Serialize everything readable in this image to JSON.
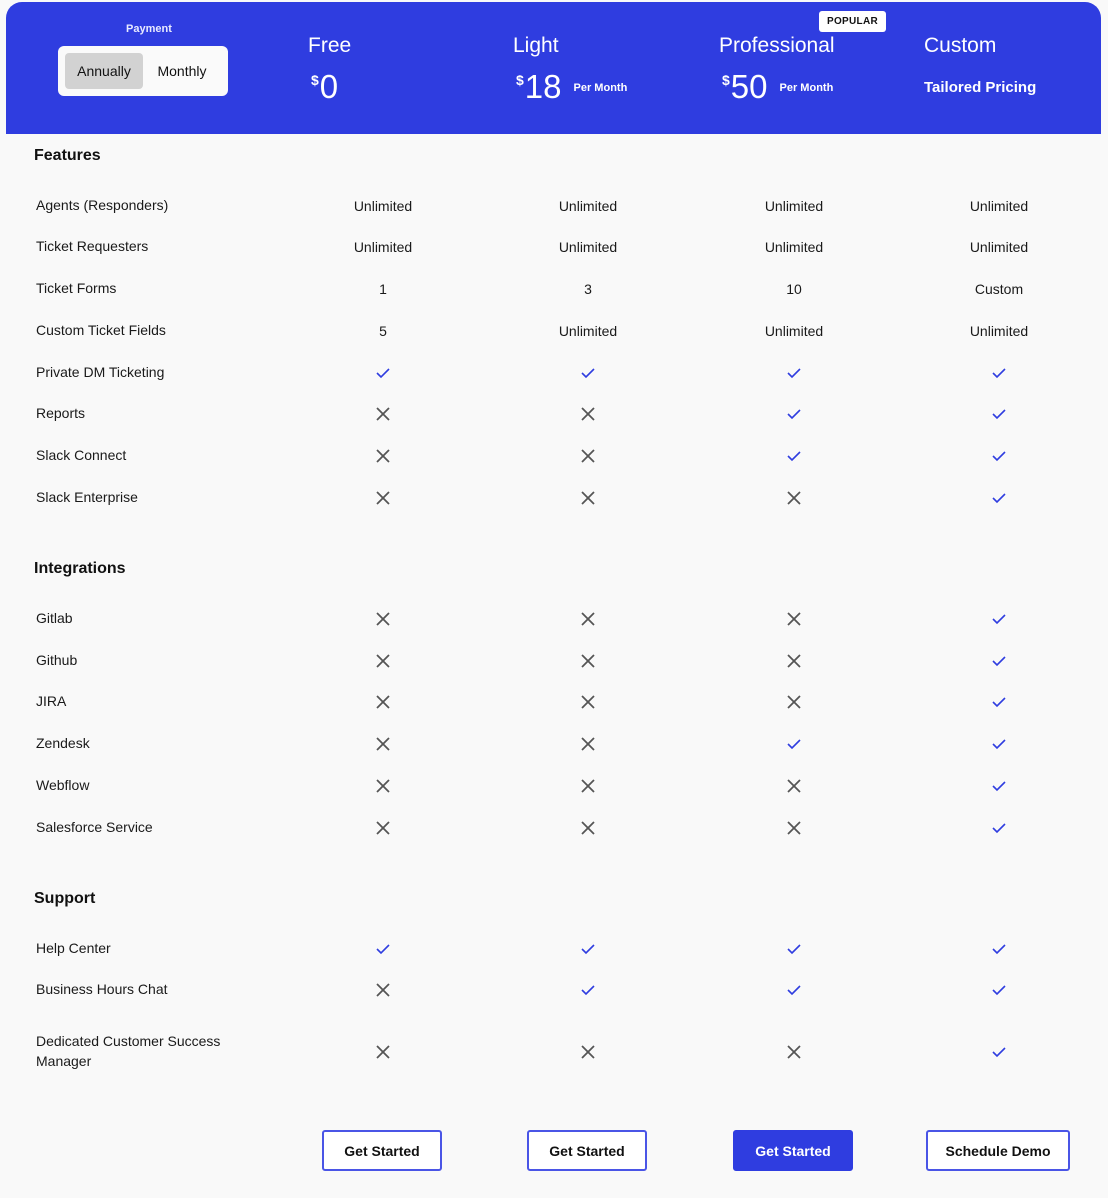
{
  "colors": {
    "accent": "#2f3de0",
    "check": "#2f3de0",
    "cross": "#555555",
    "background": "#f9f9f9"
  },
  "payment": {
    "label": "Payment",
    "options": [
      "Annually",
      "Monthly"
    ],
    "selected": "Annually"
  },
  "plans": [
    {
      "name": "Free",
      "currency": "$",
      "amount": "0",
      "period": ""
    },
    {
      "name": "Light",
      "currency": "$",
      "amount": "18",
      "period": "Per Month"
    },
    {
      "name": "Professional",
      "currency": "$",
      "amount": "50",
      "period": "Per Month",
      "badge": "POPULAR"
    },
    {
      "name": "Custom",
      "pricing_text": "Tailored Pricing"
    }
  ],
  "sections": [
    {
      "title": "Features",
      "rows": [
        {
          "label": "Agents (Responders)",
          "values": [
            "Unlimited",
            "Unlimited",
            "Unlimited",
            "Unlimited"
          ]
        },
        {
          "label": "Ticket Requesters",
          "values": [
            "Unlimited",
            "Unlimited",
            "Unlimited",
            "Unlimited"
          ]
        },
        {
          "label": "Ticket Forms",
          "values": [
            "1",
            "3",
            "10",
            "Custom"
          ]
        },
        {
          "label": "Custom Ticket Fields",
          "values": [
            "5",
            "Unlimited",
            "Unlimited",
            "Unlimited"
          ]
        },
        {
          "label": "Private DM Ticketing",
          "values": [
            "check",
            "check",
            "check",
            "check"
          ]
        },
        {
          "label": "Reports",
          "values": [
            "cross",
            "cross",
            "check",
            "check"
          ]
        },
        {
          "label": "Slack Connect",
          "values": [
            "cross",
            "cross",
            "check",
            "check"
          ]
        },
        {
          "label": "Slack Enterprise",
          "values": [
            "cross",
            "cross",
            "cross",
            "check"
          ]
        }
      ]
    },
    {
      "title": "Integrations",
      "rows": [
        {
          "label": "Gitlab",
          "values": [
            "cross",
            "cross",
            "cross",
            "check"
          ]
        },
        {
          "label": "Github",
          "values": [
            "cross",
            "cross",
            "cross",
            "check"
          ]
        },
        {
          "label": "JIRA",
          "values": [
            "cross",
            "cross",
            "cross",
            "check"
          ]
        },
        {
          "label": "Zendesk",
          "values": [
            "cross",
            "cross",
            "check",
            "check"
          ]
        },
        {
          "label": "Webflow",
          "values": [
            "cross",
            "cross",
            "cross",
            "check"
          ]
        },
        {
          "label": "Salesforce Service",
          "values": [
            "cross",
            "cross",
            "cross",
            "check"
          ]
        }
      ]
    },
    {
      "title": "Support",
      "rows": [
        {
          "label": "Help Center",
          "values": [
            "check",
            "check",
            "check",
            "check"
          ]
        },
        {
          "label": "Business Hours Chat",
          "values": [
            "cross",
            "check",
            "check",
            "check"
          ]
        },
        {
          "label": "Dedicated Customer Success Manager",
          "values": [
            "cross",
            "cross",
            "cross",
            "check"
          ]
        }
      ]
    }
  ],
  "buttons": [
    {
      "label": "Get Started",
      "style": "outline"
    },
    {
      "label": "Get Started",
      "style": "outline"
    },
    {
      "label": "Get Started",
      "style": "primary"
    },
    {
      "label": "Schedule Demo",
      "style": "outline"
    }
  ]
}
